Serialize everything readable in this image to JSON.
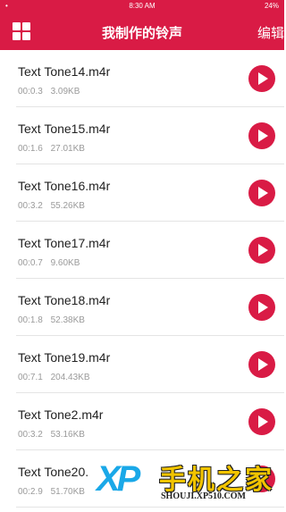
{
  "status_bar": {
    "left": "•",
    "center": "8:30 AM",
    "right": "24%"
  },
  "navbar": {
    "title": "我制作的铃声",
    "edit_label": "编辑"
  },
  "ringtones": [
    {
      "name": "Text Tone14.m4r",
      "duration": "00:0.3",
      "size": "3.09KB"
    },
    {
      "name": "Text Tone15.m4r",
      "duration": "00:1.6",
      "size": "27.01KB"
    },
    {
      "name": "Text Tone16.m4r",
      "duration": "00:3.2",
      "size": "55.26KB"
    },
    {
      "name": "Text Tone17.m4r",
      "duration": "00:0.7",
      "size": "9.60KB"
    },
    {
      "name": "Text Tone18.m4r",
      "duration": "00:1.8",
      "size": "52.38KB"
    },
    {
      "name": "Text Tone19.m4r",
      "duration": "00:7.1",
      "size": "204.43KB"
    },
    {
      "name": "Text Tone2.m4r",
      "duration": "00:3.2",
      "size": "53.16KB"
    },
    {
      "name": "Text Tone20.",
      "duration": "00:2.9",
      "size": "51.70KB"
    }
  ],
  "watermark": {
    "logo": "XP",
    "brand": "手机之家",
    "url": "SHOUJI.XP510.COM"
  },
  "colors": {
    "accent": "#d91b45"
  }
}
